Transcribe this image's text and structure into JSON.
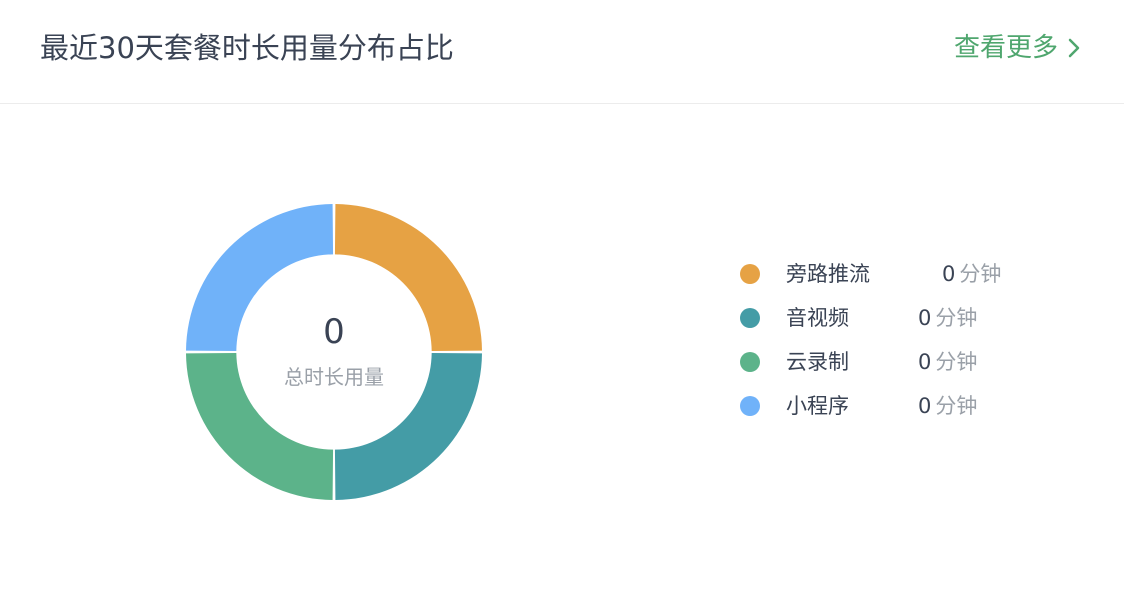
{
  "header": {
    "title": "最近30天套餐时长用量分布占比",
    "more_label": "查看更多"
  },
  "summary": {
    "total_value": "0",
    "total_label": "总时长用量"
  },
  "legend": [
    {
      "name": "旁路推流",
      "value": "0",
      "unit": "分钟",
      "color": "#E6A244"
    },
    {
      "name": "音视频",
      "value": "0",
      "unit": "分钟",
      "color": "#449CA6"
    },
    {
      "name": "云录制",
      "value": "0",
      "unit": "分钟",
      "color": "#5CB38A"
    },
    {
      "name": "小程序",
      "value": "0",
      "unit": "分钟",
      "color": "#70B2F9"
    }
  ],
  "chart_data": {
    "type": "pie",
    "categories": [
      "旁路推流",
      "音视频",
      "云录制",
      "小程序"
    ],
    "values": [
      0,
      0,
      0,
      0
    ],
    "display_shares": [
      25,
      25,
      25,
      25
    ],
    "colors": [
      "#E6A244",
      "#449CA6",
      "#5CB38A",
      "#70B2F9"
    ],
    "inner_radius_ratio": 0.66,
    "center_text": "0",
    "center_label": "总时长用量",
    "legend_position": "right"
  },
  "colors": {
    "title": "#3A4354",
    "accent": "#4FA66E",
    "muted": "#9AA0A8",
    "divider": "#ECECEC"
  }
}
